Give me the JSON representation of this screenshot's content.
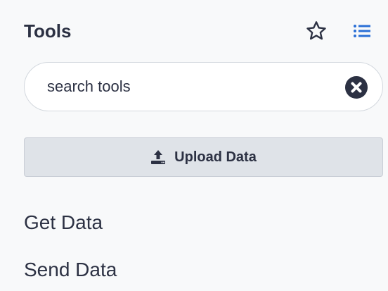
{
  "panel": {
    "title": "Tools",
    "favorites_icon": "star-outline-icon",
    "panel_view_icon": "list-icon"
  },
  "search": {
    "placeholder": "search tools",
    "value": "",
    "clear_icon": "clear-circle-x-icon"
  },
  "upload": {
    "label": "Upload Data",
    "icon": "upload-icon"
  },
  "sections": [
    {
      "label": "Get Data"
    },
    {
      "label": "Send Data"
    }
  ],
  "colors": {
    "panel_background": "#f8f9fa",
    "text": "#2c3143",
    "button_background": "#dfe3e8"
  }
}
